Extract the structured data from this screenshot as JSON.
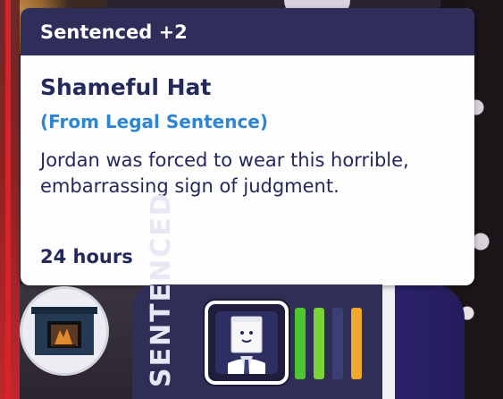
{
  "tooltip": {
    "header": "Sentenced +2",
    "title": "Shameful Hat",
    "source": "(From Legal Sentence)",
    "description": "Jordan was forced to wear this horrible, embarrassing sign of judgment.",
    "duration": "24 hours"
  },
  "panel": {
    "label": "SENTENCED",
    "moodlet_icon": "paper-bag-head-icon",
    "bars": [
      {
        "color": "#4bc62f"
      },
      {
        "color": "#7ad234"
      },
      {
        "color": "#3a3f76"
      },
      {
        "color": "#f4a82a"
      }
    ]
  },
  "object": {
    "icon": "fireplace-icon"
  },
  "colors": {
    "header_bg": "#2f2e5b",
    "title_text": "#23295a",
    "source_text": "#2d86d2",
    "panel_bg": "#2f2e56"
  }
}
